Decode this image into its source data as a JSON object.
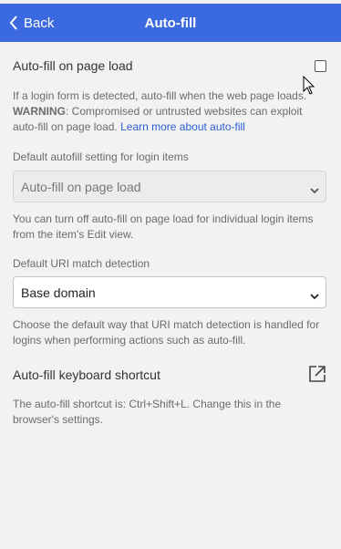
{
  "header": {
    "back_label": "Back",
    "title": "Auto-fill"
  },
  "autofill_on_page_load": {
    "label": "Auto-fill on page load",
    "checked": false,
    "help_line1": "If a login form is detected, auto-fill when the web page loads.",
    "warning_label": "WARNING",
    "help_warning_rest": ": Compromised or untrusted websites can exploit auto-fill on page load. ",
    "learn_more": "Learn more about auto-fill"
  },
  "default_autofill": {
    "label": "Default autofill setting for login items",
    "value": "Auto-fill on page load",
    "help": "You can turn off auto-fill on page load for individual login items from the item's Edit view."
  },
  "uri_match": {
    "label": "Default URI match detection",
    "value": "Base domain",
    "help": "Choose the default way that URI match detection is handled for logins when performing actions such as auto-fill."
  },
  "shortcut": {
    "label": "Auto-fill keyboard shortcut",
    "help": "The auto-fill shortcut is: Ctrl+Shift+L. Change this in the browser's settings."
  },
  "icons": {
    "back": "chevron-left-icon",
    "select_chevron": "chevron-down-icon",
    "external": "external-link-icon"
  },
  "colors": {
    "header_bg": "#3a69e0",
    "link": "#2c5fd6",
    "page_bg": "#f2f2f2"
  }
}
